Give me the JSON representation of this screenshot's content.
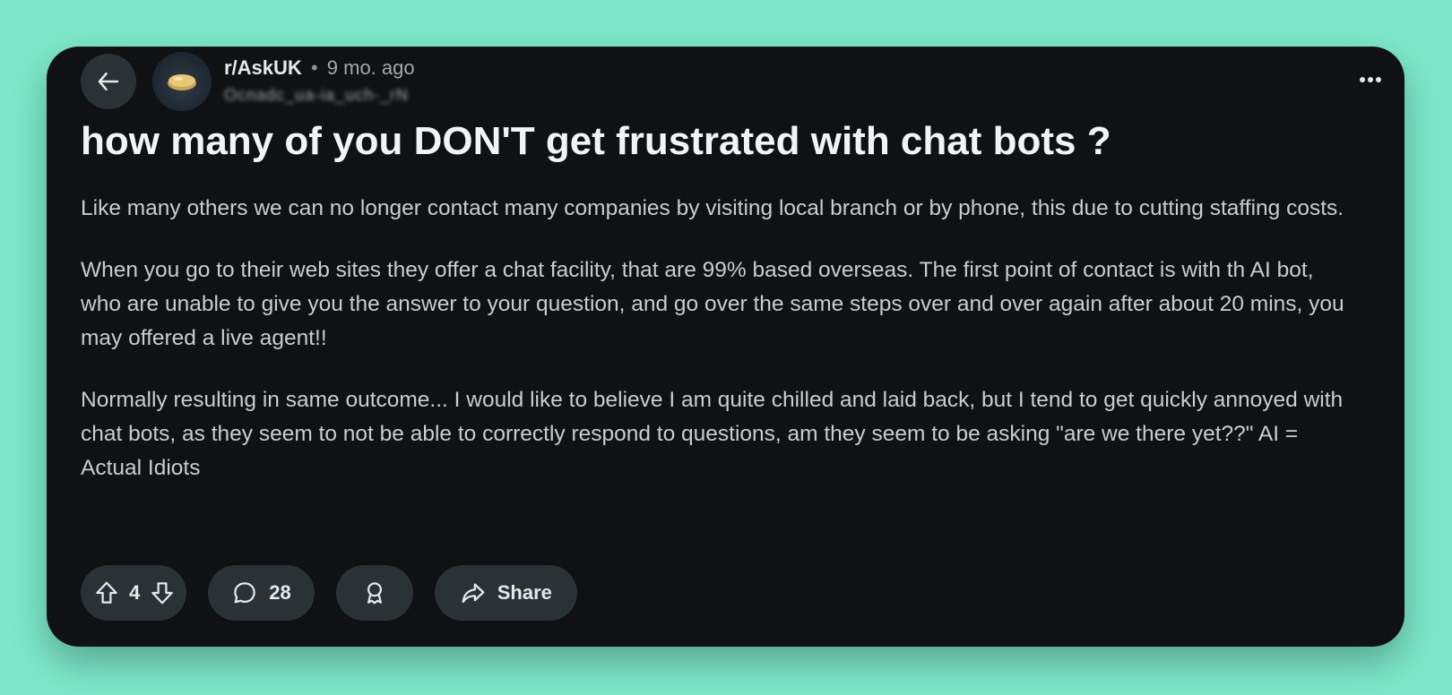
{
  "post": {
    "subreddit": "r/AskUK",
    "separator": "•",
    "age": "9 mo. ago",
    "author": "Ocnadc_ua-ia_uch-_rN",
    "title": "how many of you DON'T get frustrated with chat bots ?",
    "paragraphs": [
      "Like many others we can no longer contact many companies by visiting local branch or by phone, this due to cutting staffing costs.",
      "When you go to their web sites they offer a chat facility, that are 99% based overseas. The first point of contact is with th AI bot, who are unable to give you the answer to your question, and go over the same steps over and over again after about 20 mins, you may offered a live agent!!",
      "Normally resulting in same outcome... I would like to believe I am quite chilled and laid back, but I tend to get quickly annoyed with chat bots, as they seem to not be able to correctly respond to questions, am they seem to be asking \"are we there yet??\" AI = Actual Idiots"
    ]
  },
  "actions": {
    "vote_count": "4",
    "comment_count": "28",
    "share_label": "Share"
  },
  "icons": {
    "back": "arrow-left-icon",
    "more": "more-horizontal-icon",
    "upvote": "arrow-up-icon",
    "downvote": "arrow-down-icon",
    "comment": "comment-bubble-icon",
    "award": "award-icon",
    "share": "share-arrow-icon"
  },
  "colors": {
    "page_background": "#7de8c9",
    "card_background": "#0f1113",
    "pill_background": "#2a3236",
    "text_primary": "#f2f3f4",
    "text_body": "#c9cdd0"
  }
}
